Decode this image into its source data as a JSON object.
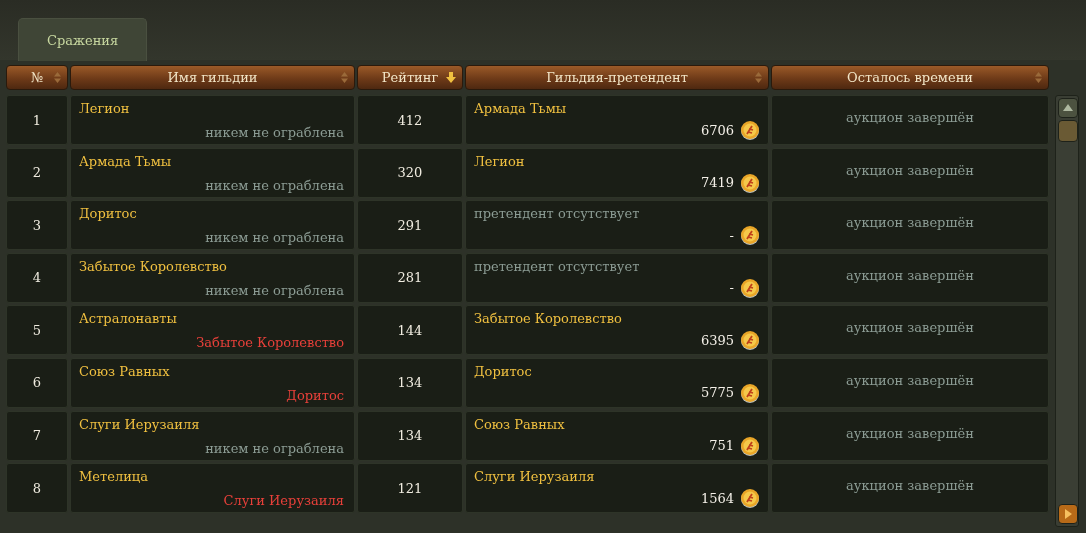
{
  "tabs": [
    {
      "label": "Сражения",
      "selected": true
    }
  ],
  "table": {
    "columns": [
      {
        "label": "№",
        "sorted": false
      },
      {
        "label": "Имя гильдии",
        "sorted": false
      },
      {
        "label": "Рейтинг",
        "sorted": true
      },
      {
        "label": "Гильдия-претендент",
        "sorted": false
      },
      {
        "label": "Осталось времени",
        "sorted": false
      }
    ],
    "rows": [
      {
        "number": "1",
        "guild": "Легион",
        "robbed_by": {
          "text": "никем не ограблена",
          "robbed": false
        },
        "rating": "412",
        "challenger": {
          "name": "Армада Тьмы",
          "absent": false,
          "bid": "6706"
        },
        "time_left": "аукцион завершён"
      },
      {
        "number": "2",
        "guild": "Армада Тьмы",
        "robbed_by": {
          "text": "никем не ограблена",
          "robbed": false
        },
        "rating": "320",
        "challenger": {
          "name": "Легион",
          "absent": false,
          "bid": "7419"
        },
        "time_left": "аукцион завершён"
      },
      {
        "number": "3",
        "guild": "Доритос",
        "robbed_by": {
          "text": "никем не ограблена",
          "robbed": false
        },
        "rating": "291",
        "challenger": {
          "name": "претендент отсутствует",
          "absent": true,
          "bid": "-"
        },
        "time_left": "аукцион завершён"
      },
      {
        "number": "4",
        "guild": "Забытое Королевство",
        "robbed_by": {
          "text": "никем не ограблена",
          "robbed": false
        },
        "rating": "281",
        "challenger": {
          "name": "претендент отсутствует",
          "absent": true,
          "bid": "-"
        },
        "time_left": "аукцион завершён"
      },
      {
        "number": "5",
        "guild": "Астралонавты",
        "robbed_by": {
          "text": "Забытое Королевство",
          "robbed": true
        },
        "rating": "144",
        "challenger": {
          "name": "Забытое Королевство",
          "absent": false,
          "bid": "6395"
        },
        "time_left": "аукцион завершён"
      },
      {
        "number": "6",
        "guild": "Союз Равных",
        "robbed_by": {
          "text": "Доритос",
          "robbed": true
        },
        "rating": "134",
        "challenger": {
          "name": "Доритос",
          "absent": false,
          "bid": "5775"
        },
        "time_left": "аукцион завершён"
      },
      {
        "number": "7",
        "guild": "Слуги Иерузаиля",
        "robbed_by": {
          "text": "никем не ограблена",
          "robbed": false
        },
        "rating": "134",
        "challenger": {
          "name": "Союз Равных",
          "absent": false,
          "bid": "751"
        },
        "time_left": "аукцион завершён"
      },
      {
        "number": "8",
        "guild": "Метелица",
        "robbed_by": {
          "text": "Слуги Иерузаиля",
          "robbed": true
        },
        "rating": "121",
        "challenger": {
          "name": "Слуги Иерузаиля",
          "absent": false,
          "bid": "1564"
        },
        "time_left": "аукцион завершён"
      }
    ]
  }
}
